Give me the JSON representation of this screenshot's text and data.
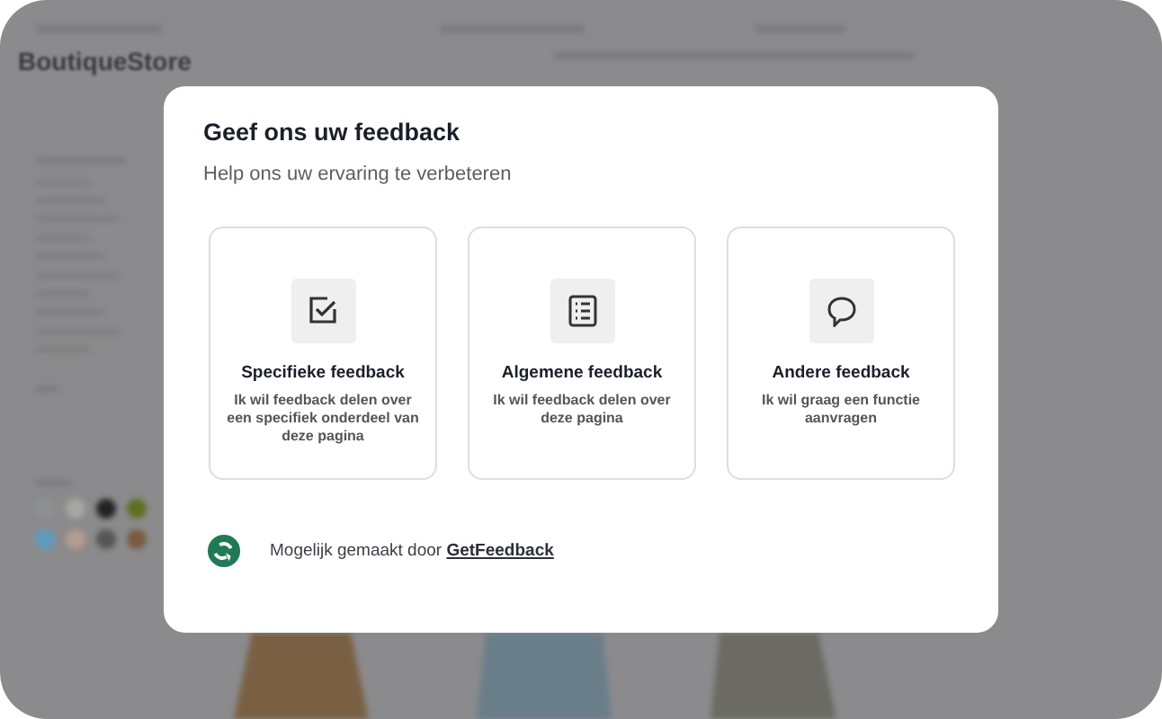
{
  "background": {
    "logo": "BoutiqueStore"
  },
  "dialog": {
    "title": "Geef ons uw feedback",
    "subtitle": "Help ons uw ervaring te verbeteren",
    "options": [
      {
        "kind": "specific",
        "title": "Specifieke feedback",
        "description": "Ik wil feedback delen over een specifiek onderdeel van deze pagina"
      },
      {
        "kind": "general",
        "title": "Algemene feedback",
        "description": "Ik wil feedback delen over deze pagina"
      },
      {
        "kind": "other",
        "title": "Andere feedback",
        "description": "Ik wil graag een functie aanvragen"
      }
    ],
    "footer": {
      "text": "Mogelijk gemaakt door",
      "link": "GetFeedback"
    }
  }
}
